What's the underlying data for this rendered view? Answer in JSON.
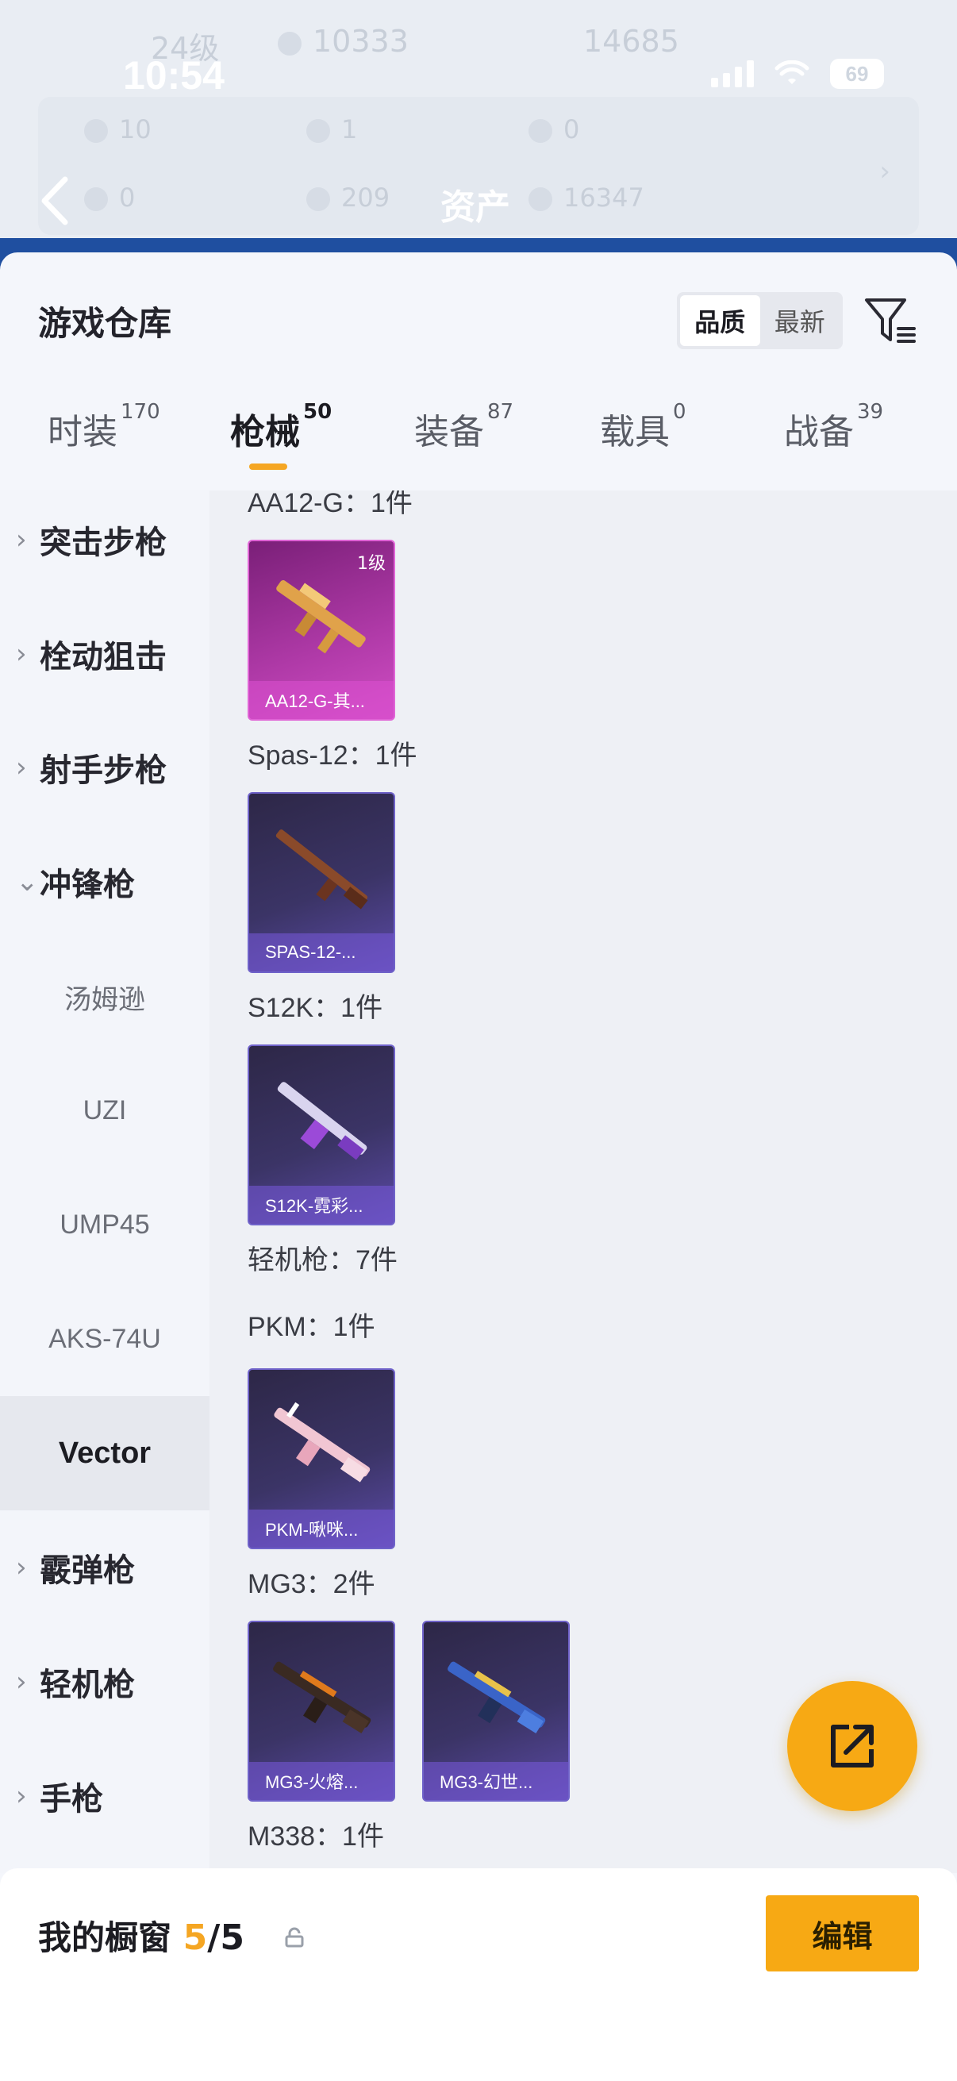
{
  "status": {
    "time": "10:54",
    "battery": "69"
  },
  "header": {
    "title": "资产",
    "ghost": {
      "level": "24级",
      "coins": "10333",
      "score": "14685",
      "row1": [
        "10",
        "1",
        "0"
      ],
      "row2": [
        "0",
        "209",
        "16347"
      ]
    }
  },
  "sheet": {
    "title": "游戏仓库",
    "sort": {
      "quality": "品质",
      "latest": "最新"
    }
  },
  "tabs": [
    {
      "label": "时装",
      "count": "170"
    },
    {
      "label": "枪械",
      "count": "50"
    },
    {
      "label": "装备",
      "count": "87"
    },
    {
      "label": "载具",
      "count": "0"
    },
    {
      "label": "战备",
      "count": "39"
    }
  ],
  "sidebar": {
    "categories": [
      "突击步枪",
      "栓动狙击",
      "射手步枪",
      "冲锋枪",
      "霰弹枪",
      "轻机枪",
      "手枪"
    ],
    "smg_items": [
      "汤姆逊",
      "UZI",
      "UMP45",
      "AKS-74U",
      "Vector"
    ]
  },
  "content": {
    "groups": [
      {
        "title": "AA12-G：1件"
      },
      {
        "title": "Spas-12：1件"
      },
      {
        "title": "S12K：1件"
      },
      {
        "title": "轻机枪：7件"
      },
      {
        "title": "PKM：1件"
      },
      {
        "title": "MG3：2件"
      },
      {
        "title": "M338：1件"
      }
    ],
    "cards": [
      {
        "name": "AA12-G-其...",
        "level": "1级"
      },
      {
        "name": "SPAS-12-..."
      },
      {
        "name": "S12K-霓彩..."
      },
      {
        "name": "PKM-啾咪..."
      },
      {
        "name": "MG3-火熔..."
      },
      {
        "name": "MG3-幻世..."
      }
    ]
  },
  "showcase": {
    "title": "我的橱窗",
    "current": "5",
    "separator": "/",
    "total": "5",
    "edit_label": "编辑"
  },
  "colors": {
    "accent": "#f7a914",
    "tab_indicator": "#f5a623",
    "epic_card": "#5b4aa6",
    "legendary_card": "#b03aa8"
  }
}
